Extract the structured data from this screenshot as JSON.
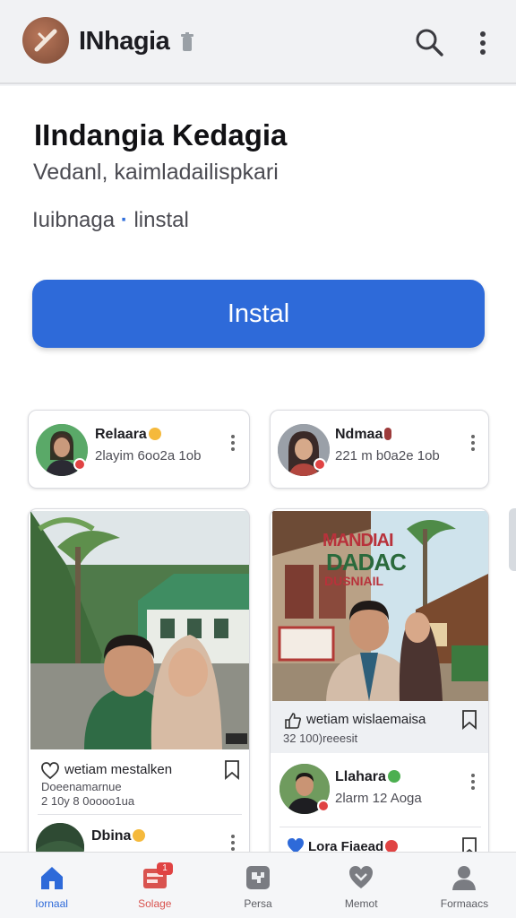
{
  "header": {
    "title": "INhagia",
    "logo_icon": "app-logo-icon",
    "search_icon": "search-icon",
    "menu_icon": "more-vert-icon"
  },
  "main": {
    "headline": "IIndangia Kedagia",
    "subline": "Vedanl, kaimladailispkari",
    "source_text": "Iuibnaga",
    "source_separator": "·",
    "source_action": "linstal",
    "install_label": "Instal"
  },
  "cards": {
    "left_top": {
      "name": "Relaara",
      "meta": "2layim 6oo2a 1ob"
    },
    "right_top": {
      "name": "Ndmaa",
      "meta": "221 m b0a2e 1ob"
    },
    "left_post": {
      "caption": "wetiam mestalken",
      "meta": "Doeenamarnue",
      "meta2": "2 10y 8 0oooo1ua"
    },
    "left_bottom": {
      "name": "Dbina"
    },
    "right_post": {
      "caption": "wetiam wislaemaisa",
      "meta": "32 100)reeesit",
      "poster_text_1": "MANDIAI",
      "poster_text_2": "DADAC",
      "poster_text_3": "DUSNIAIL"
    },
    "right_mid": {
      "name": "Llahara",
      "meta": "2larm 12 Aoga"
    },
    "right_bottom": {
      "name": "Lora Fiaead"
    }
  },
  "nav": {
    "items": [
      {
        "label": "Iornaal",
        "icon": "home-icon",
        "active": true
      },
      {
        "label": "Solage",
        "icon": "inbox-icon",
        "active": false,
        "badge": "1"
      },
      {
        "label": "Persa",
        "icon": "puzzle-icon",
        "active": false
      },
      {
        "label": "Memot",
        "icon": "heart-icon",
        "active": false
      },
      {
        "label": "Formaacs",
        "icon": "person-icon",
        "active": false
      }
    ]
  },
  "colors": {
    "accent": "#2e6ad9",
    "badge": "#e04343",
    "appbar": "#f1f2f4"
  }
}
